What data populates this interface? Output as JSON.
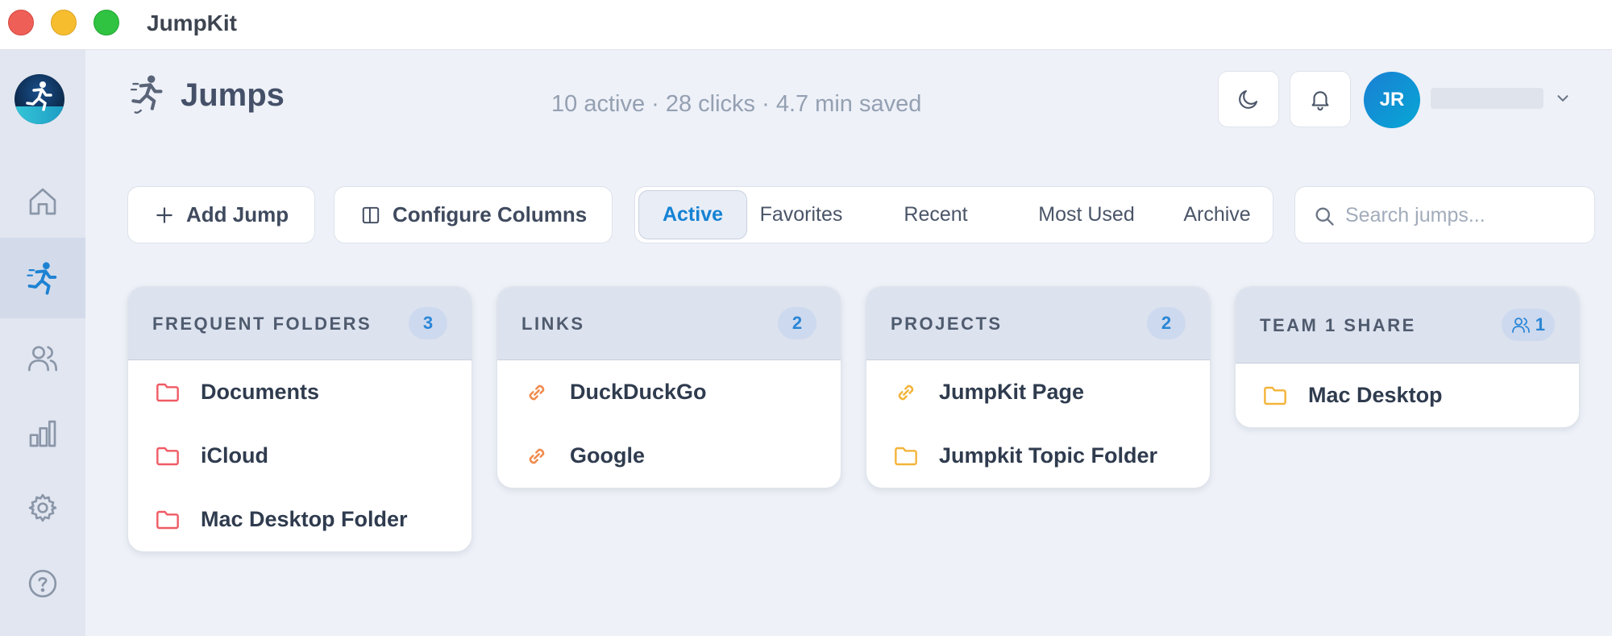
{
  "window": {
    "title": "JumpKit"
  },
  "sidebar": {
    "items": [
      {
        "name": "home",
        "icon": "home-icon"
      },
      {
        "name": "jumps",
        "icon": "runner-icon",
        "active": true
      },
      {
        "name": "team",
        "icon": "users-icon"
      },
      {
        "name": "analytics",
        "icon": "bar-chart-icon"
      },
      {
        "name": "settings",
        "icon": "gear-icon"
      },
      {
        "name": "help",
        "icon": "help-icon"
      }
    ]
  },
  "header": {
    "title": "Jumps",
    "stats": "10 active · 28 clicks · 4.7 min saved",
    "user_initials": "JR"
  },
  "toolbar": {
    "add_label": "Add Jump",
    "configure_label": "Configure Columns",
    "search_placeholder": "Search jumps..."
  },
  "tabs": [
    {
      "label": "Active",
      "active": true
    },
    {
      "label": "Favorites"
    },
    {
      "label": "Recent"
    },
    {
      "label": "Most Used"
    },
    {
      "label": "Archive"
    }
  ],
  "columns": [
    {
      "title": "FREQUENT FOLDERS",
      "count": "3",
      "items": [
        {
          "label": "Documents",
          "icon": "folder-icon",
          "color": "#ef5b65"
        },
        {
          "label": "iCloud",
          "icon": "folder-icon",
          "color": "#ef5b65"
        },
        {
          "label": "Mac Desktop Folder",
          "icon": "folder-icon",
          "color": "#ef5b65"
        }
      ]
    },
    {
      "title": "LINKS",
      "count": "2",
      "items": [
        {
          "label": "DuckDuckGo",
          "icon": "link-icon",
          "color": "#f08a4b"
        },
        {
          "label": "Google",
          "icon": "link-icon",
          "color": "#f08a4b"
        }
      ]
    },
    {
      "title": "PROJECTS",
      "count": "2",
      "items": [
        {
          "label": "JumpKit Page",
          "icon": "link-icon",
          "color": "#f3b43a"
        },
        {
          "label": "Jumpkit Topic Folder",
          "icon": "folder-icon",
          "color": "#f3b43a"
        }
      ]
    },
    {
      "title": "TEAM 1 SHARE",
      "count": "1",
      "shared": true,
      "items": [
        {
          "label": "Mac Desktop",
          "icon": "folder-icon",
          "color": "#f3b43a"
        }
      ]
    }
  ],
  "colors": {
    "accent": "#1582d4",
    "folder_red": "#ef5b65",
    "link_orange": "#f08a4b",
    "project_yellow": "#f3b43a"
  }
}
